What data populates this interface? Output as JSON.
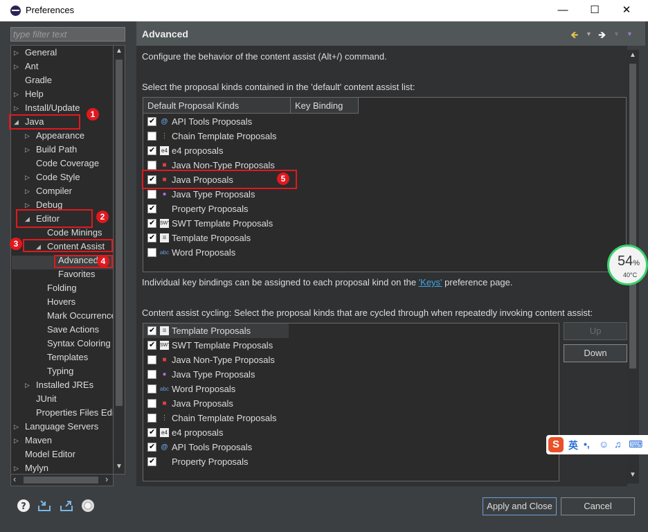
{
  "window": {
    "title": "Preferences",
    "minimize": "—",
    "maximize": "☐",
    "close": "✕"
  },
  "filter": {
    "placeholder": "type filter text"
  },
  "tree": [
    {
      "label": "General",
      "twist": "▷"
    },
    {
      "label": "Ant",
      "twist": "▷"
    },
    {
      "label": "Gradle",
      "twist": ""
    },
    {
      "label": "Help",
      "twist": "▷"
    },
    {
      "label": "Install/Update",
      "twist": "▷"
    },
    {
      "label": "Java",
      "twist": "◢"
    },
    {
      "label": "Appearance",
      "twist": "▷"
    },
    {
      "label": "Build Path",
      "twist": "▷"
    },
    {
      "label": "Code Coverage",
      "twist": ""
    },
    {
      "label": "Code Style",
      "twist": "▷"
    },
    {
      "label": "Compiler",
      "twist": "▷"
    },
    {
      "label": "Debug",
      "twist": "▷"
    },
    {
      "label": "Editor",
      "twist": "◢"
    },
    {
      "label": "Code Minings",
      "twist": ""
    },
    {
      "label": "Content Assist",
      "twist": "◢"
    },
    {
      "label": "Advanced",
      "twist": ""
    },
    {
      "label": "Favorites",
      "twist": ""
    },
    {
      "label": "Folding",
      "twist": ""
    },
    {
      "label": "Hovers",
      "twist": ""
    },
    {
      "label": "Mark Occurrences",
      "twist": ""
    },
    {
      "label": "Save Actions",
      "twist": ""
    },
    {
      "label": "Syntax Coloring",
      "twist": ""
    },
    {
      "label": "Templates",
      "twist": ""
    },
    {
      "label": "Typing",
      "twist": ""
    },
    {
      "label": "Installed JREs",
      "twist": "▷"
    },
    {
      "label": "JUnit",
      "twist": ""
    },
    {
      "label": "Properties Files Editor",
      "twist": ""
    },
    {
      "label": "Language Servers",
      "twist": "▷"
    },
    {
      "label": "Maven",
      "twist": "▷"
    },
    {
      "label": "Model Editor",
      "twist": ""
    },
    {
      "label": "Mylyn",
      "twist": "▷"
    }
  ],
  "annotations": [
    "1",
    "2",
    "3",
    "4",
    "5"
  ],
  "page": {
    "title": "Advanced",
    "description": "Configure the behavior of the content assist (Alt+/) command.",
    "default_list_label": "Select the proposal kinds contained in the 'default' content assist list:",
    "columns": [
      "Default Proposal Kinds",
      "Key Binding"
    ],
    "default_kinds": [
      {
        "label": "API Tools Proposals",
        "checked": true,
        "icon": "api-tools-icon"
      },
      {
        "label": "Chain Template Proposals",
        "checked": false,
        "icon": "chain-template-icon"
      },
      {
        "label": "e4 proposals",
        "checked": true,
        "icon": "e4-icon"
      },
      {
        "label": "Java Non-Type Proposals",
        "checked": false,
        "icon": "java-non-type-icon"
      },
      {
        "label": "Java Proposals",
        "checked": true,
        "icon": "java-proposals-icon"
      },
      {
        "label": "Java Type Proposals",
        "checked": false,
        "icon": "java-type-icon"
      },
      {
        "label": "Property Proposals",
        "checked": true,
        "icon": ""
      },
      {
        "label": "SWT Template Proposals",
        "checked": true,
        "icon": "swt-template-icon"
      },
      {
        "label": "Template Proposals",
        "checked": true,
        "icon": "template-icon"
      },
      {
        "label": "Word Proposals",
        "checked": false,
        "icon": "word-icon"
      }
    ],
    "keys_note_before": "Individual key bindings can be assigned to each proposal kind on the ",
    "keys_link": "'Keys'",
    "keys_note_after": " preference page.",
    "cycling_label": "Content assist cycling: Select the proposal kinds that are cycled through when repeatedly invoking content assist:",
    "cycling_kinds": [
      {
        "label": "Template Proposals",
        "checked": true,
        "icon": "template-icon"
      },
      {
        "label": "SWT Template Proposals",
        "checked": true,
        "icon": "swt-template-icon"
      },
      {
        "label": "Java Non-Type Proposals",
        "checked": false,
        "icon": "java-non-type-icon"
      },
      {
        "label": "Java Type Proposals",
        "checked": false,
        "icon": "java-type-icon"
      },
      {
        "label": "Word Proposals",
        "checked": false,
        "icon": "word-icon"
      },
      {
        "label": "Java Proposals",
        "checked": false,
        "icon": "java-proposals-icon"
      },
      {
        "label": "Chain Template Proposals",
        "checked": false,
        "icon": "chain-template-icon"
      },
      {
        "label": "e4 proposals",
        "checked": true,
        "icon": "e4-icon"
      },
      {
        "label": "API Tools Proposals",
        "checked": true,
        "icon": "api-tools-icon"
      },
      {
        "label": "Property Proposals",
        "checked": true,
        "icon": ""
      }
    ],
    "up_label": "Up",
    "down_label": "Down"
  },
  "footer": {
    "apply_close": "Apply and Close",
    "cancel": "Cancel"
  },
  "overlay": {
    "percent": "54",
    "percent_unit": "%",
    "temp": "40°C",
    "ime_char": "英"
  },
  "colors": {
    "accent_red": "#e0191f",
    "link": "#41a6e6",
    "gauge_green": "#38d26a"
  }
}
